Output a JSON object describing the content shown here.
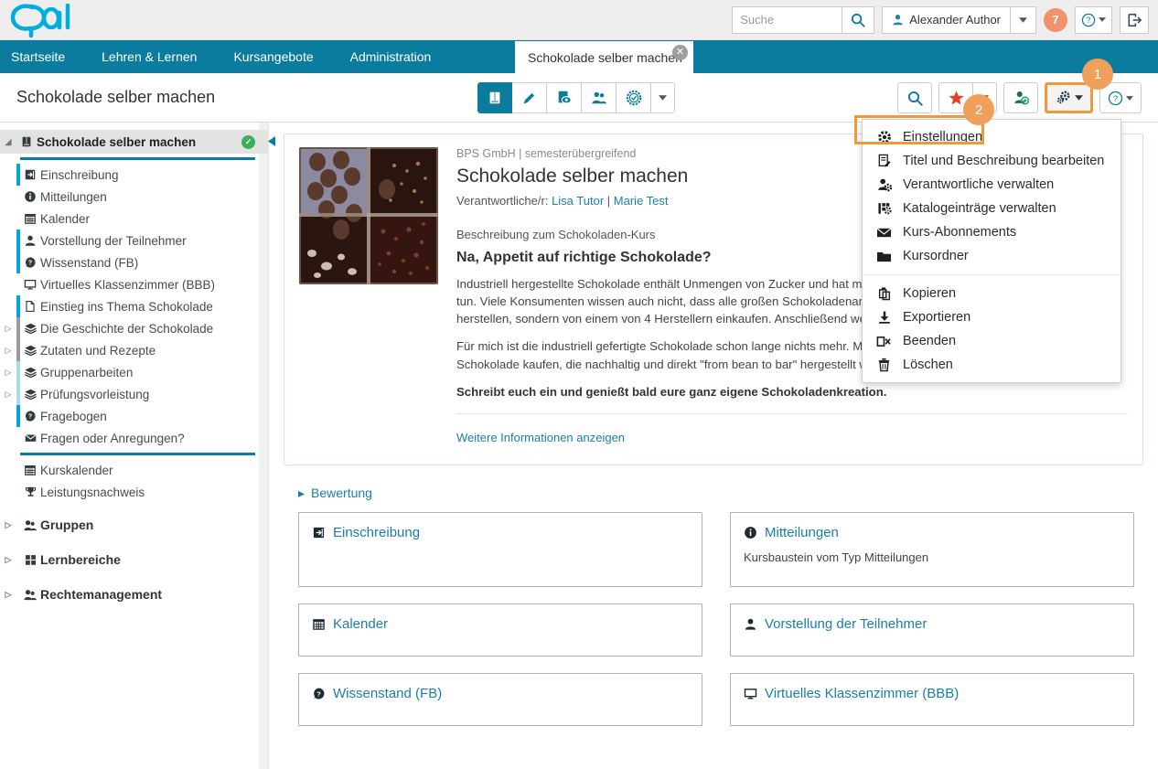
{
  "brand": {
    "logo_text": "Opal",
    "teal": "#0b7c9e",
    "cyan": "#00AEDB",
    "orange": "#F0A05A"
  },
  "topbar": {
    "search_placeholder": "Suche",
    "search_value": "",
    "user_name": "Alexander Author",
    "notification_count": "7",
    "help_label": "?",
    "logout_label": "Abmelden"
  },
  "nav": {
    "items": [
      {
        "label": "Startseite"
      },
      {
        "label": "Lehren & Lernen"
      },
      {
        "label": "Kursangebote"
      },
      {
        "label": "Administration"
      }
    ],
    "tab": {
      "label": "Schokolade selber machen",
      "close": "✕"
    }
  },
  "actionbar": {
    "title": "Schokolade selber machen",
    "center_tools": [
      {
        "name": "book-icon",
        "active": true
      },
      {
        "name": "pencil-icon",
        "active": false
      },
      {
        "name": "preview-eye-icon",
        "active": false
      },
      {
        "name": "members-icon",
        "active": false
      },
      {
        "name": "badge-check-icon",
        "active": false
      },
      {
        "name": "chevron-down-icon",
        "active": false
      }
    ],
    "right_tools": [
      {
        "name": "search-icon"
      },
      {
        "name": "star-icon"
      },
      {
        "name": "star-dropdown-caret"
      },
      {
        "name": "add-member-icon"
      },
      {
        "name": "gear-settings-icon"
      },
      {
        "name": "help-icon"
      }
    ],
    "step_markers": [
      {
        "label": "1"
      },
      {
        "label": "2"
      }
    ]
  },
  "gear_menu": {
    "groups": [
      [
        {
          "label": "Einstellungen",
          "icon": "gear-icon",
          "highlighted": true
        },
        {
          "label": "Titel und Beschreibung bearbeiten",
          "icon": "edit-document-icon"
        },
        {
          "label": "Verantwortliche verwalten",
          "icon": "manage-users-icon"
        },
        {
          "label": "Katalogeinträge verwalten",
          "icon": "catalog-icon"
        },
        {
          "label": "Kurs-Abonnements",
          "icon": "envelope-icon"
        },
        {
          "label": "Kursordner",
          "icon": "folder-icon"
        }
      ],
      [
        {
          "label": "Kopieren",
          "icon": "copy-icon"
        },
        {
          "label": "Exportieren",
          "icon": "download-icon"
        },
        {
          "label": "Beenden",
          "icon": "close-course-icon"
        },
        {
          "label": "Löschen",
          "icon": "trash-icon"
        }
      ]
    ]
  },
  "sidebar": {
    "collapse_icon": "collapse-left-icon",
    "tree": [
      {
        "label": "Schokolade selber machen",
        "icon": "book-icon",
        "root": true,
        "arrow": "◢",
        "badge": "✓"
      },
      {
        "label": "Einschreibung",
        "icon": "enrol-icon",
        "accent": "#00A5DB"
      },
      {
        "label": "Mitteilungen",
        "icon": "info-icon",
        "accent": ""
      },
      {
        "label": "Kalender",
        "icon": "calendar-icon",
        "accent": ""
      },
      {
        "label": "Vorstellung der Teilnehmer",
        "icon": "person-icon",
        "accent": "#00A5DB"
      },
      {
        "label": "Wissenstand (FB)",
        "icon": "question-bubble-icon",
        "accent": "#00A5DB"
      },
      {
        "label": "Virtuelles Klassenzimmer (BBB)",
        "icon": "monitor-icon",
        "accent": ""
      },
      {
        "label": "Einstieg ins Thema Schokolade",
        "icon": "page-icon",
        "accent": "#00A5DB"
      },
      {
        "label": "Die Geschichte der Schokolade",
        "icon": "stack-icon",
        "accent": "#9b9b9b",
        "arrow": "▷"
      },
      {
        "label": "Zutaten und Rezepte",
        "icon": "stack-icon",
        "accent": "#9b9b9b",
        "arrow": "▷"
      },
      {
        "label": "Gruppenarbeiten",
        "icon": "stack-icon",
        "accent": "#a8dced",
        "arrow": "▷"
      },
      {
        "label": "Prüfungsvorleistung",
        "icon": "stack-icon",
        "accent": "#a8dced",
        "arrow": "▷"
      },
      {
        "label": "Fragebogen",
        "icon": "question-bubble-icon",
        "accent": "#00A5DB"
      },
      {
        "label": "Fragen oder Anregungen?",
        "icon": "envelope-icon",
        "accent": ""
      }
    ],
    "tools": [
      {
        "label": "Kurskalender",
        "icon": "calendar-icon"
      },
      {
        "label": "Leistungsnachweis",
        "icon": "trophy-icon"
      }
    ],
    "groups": [
      {
        "label": "Gruppen",
        "icon": "group-icon",
        "arrow": "▷"
      },
      {
        "label": "Lernbereiche",
        "icon": "grid-icon",
        "arrow": "▷"
      },
      {
        "label": "Rechtemanagement",
        "icon": "group-icon",
        "arrow": "▷"
      }
    ]
  },
  "course_card": {
    "breadcrumb": "BPS GmbH | semesterübergreifend",
    "title": "Schokolade selber machen",
    "responsible_label": "Verantwortliche/r:",
    "responsible": [
      "Lisa Tutor",
      "Marie Test"
    ],
    "responsible_sep": "|",
    "description_label": "Beschreibung zum Schokoladen-Kurs",
    "description_heading": "Na, Appetit auf richtige Schokolade?",
    "paragraphs": [
      "Industriell hergestellte Schokolade enthält Unmengen von Zucker und hat meist nicht viel mit dem eigentlichen Produkt zu tun. Viele Konsumenten wissen auch nicht, dass alle großen Schokoladenanbieter ihre Schokolade gar nicht selbst herstellen, sondern von einem von 4 Herstellern einkaufen. Anschließend werden nur einige Zutaten beigemengt.",
      "Für mich ist die industriell gefertigte Schokolade schon lange nichts mehr. Man kann mittlerweile aber auch wunderbare Schokolade kaufen, die nachhaltig und direkt \"from bean to bar\" hergestellt wird. Rezepte und Tipps gibt es hier im Kurs."
    ],
    "paragraph_bold": "Schreibt euch ein und genießt bald eure ganz eigene Schokoladenkreation.",
    "more_info": "Weitere Informationen anzeigen"
  },
  "main": {
    "bewertung_label": "Bewertung",
    "bewertung_arrow": "▸",
    "tiles": [
      {
        "label": "Einschreibung",
        "icon": "enrol-icon",
        "sub": ""
      },
      {
        "label": "Mitteilungen",
        "icon": "info-icon",
        "sub": "Kursbaustein vom Typ Mitteilungen"
      },
      {
        "label": "Kalender",
        "icon": "calendar-icon",
        "sub": ""
      },
      {
        "label": "Vorstellung der Teilnehmer",
        "icon": "person-icon",
        "sub": ""
      },
      {
        "label": "Wissenstand (FB)",
        "icon": "question-bubble-icon",
        "sub": ""
      },
      {
        "label": "Virtuelles Klassenzimmer (BBB)",
        "icon": "monitor-icon",
        "sub": ""
      }
    ]
  }
}
